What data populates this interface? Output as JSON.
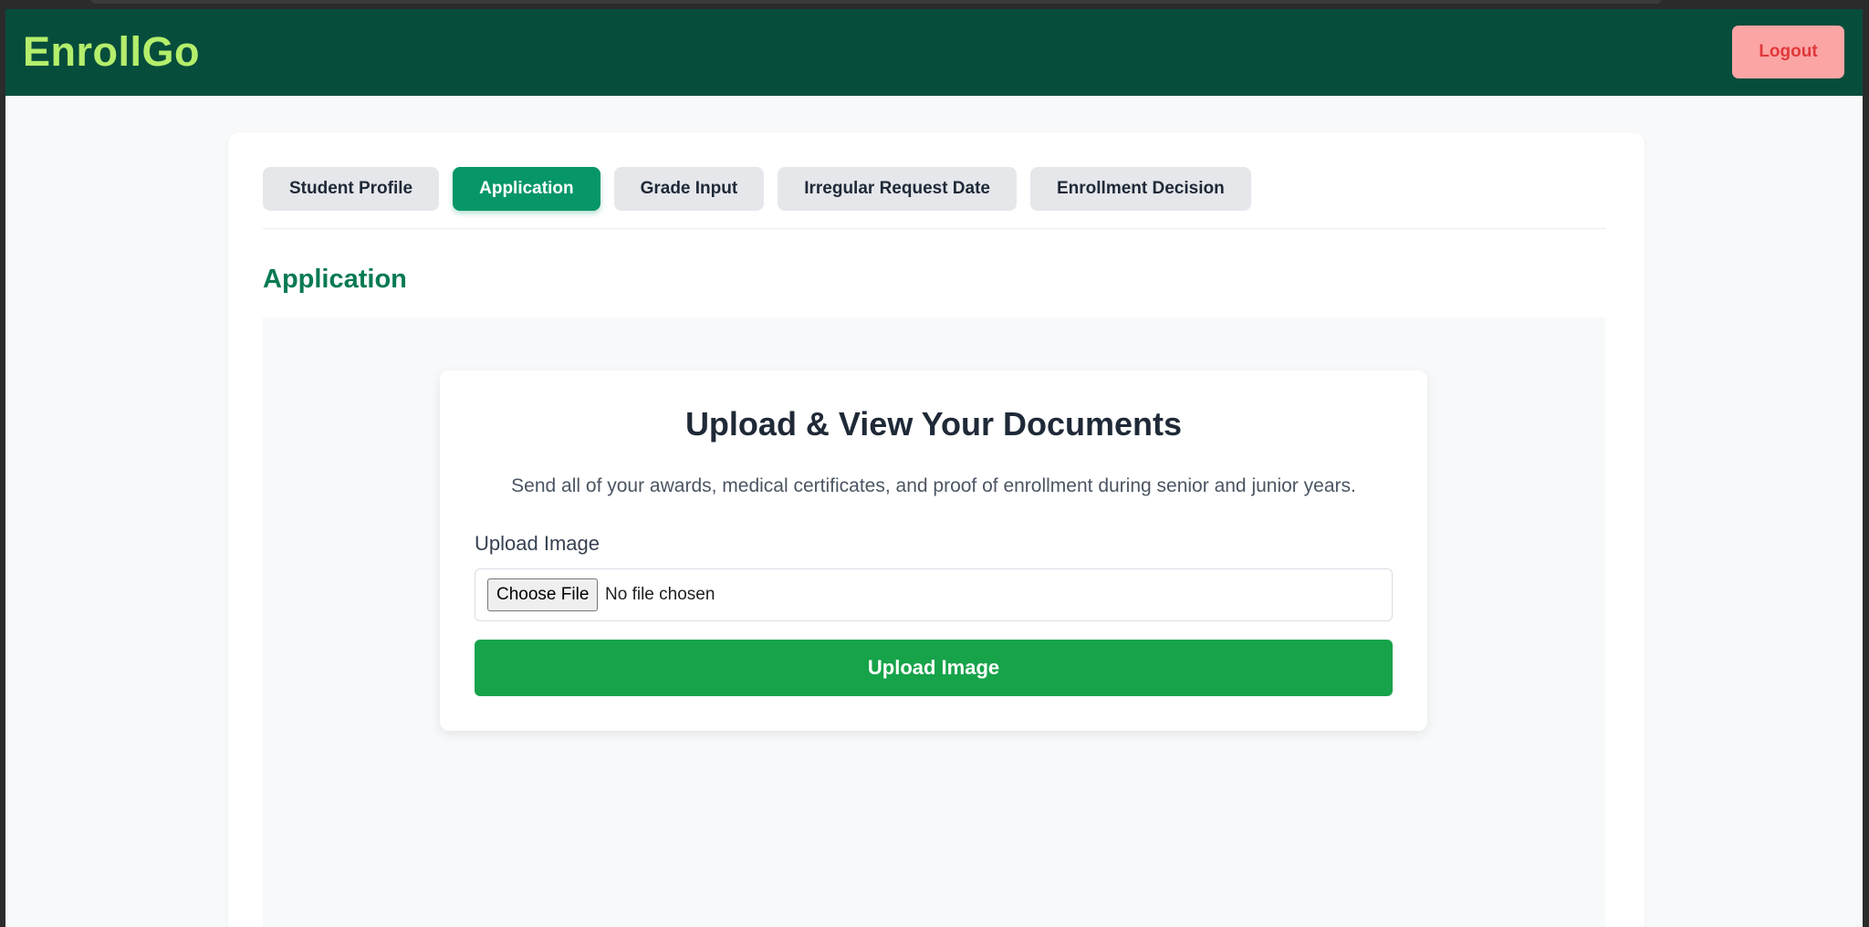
{
  "app": {
    "brand": "EnrollGo",
    "logout_label": "Logout"
  },
  "tabs": [
    {
      "label": "Student Profile",
      "active": false
    },
    {
      "label": "Application",
      "active": true
    },
    {
      "label": "Grade Input",
      "active": false
    },
    {
      "label": "Irregular Request Date",
      "active": false
    },
    {
      "label": "Enrollment Decision",
      "active": false
    }
  ],
  "section": {
    "title": "Application"
  },
  "upload": {
    "title": "Upload & View Your Documents",
    "description": "Send all of your awards, medical certificates, and proof of enrollment during senior and junior years.",
    "field_label": "Upload Image",
    "choose_file_label": "Choose File",
    "file_status": "No file chosen",
    "submit_label": "Upload Image"
  },
  "colors": {
    "navbar": "#064d3c",
    "brand": "#b4ee6b",
    "logout_bg": "#fca5a5",
    "logout_text": "#e0383a",
    "tab_active": "#069669",
    "section_title": "#087a52",
    "upload_button": "#17a34a"
  }
}
